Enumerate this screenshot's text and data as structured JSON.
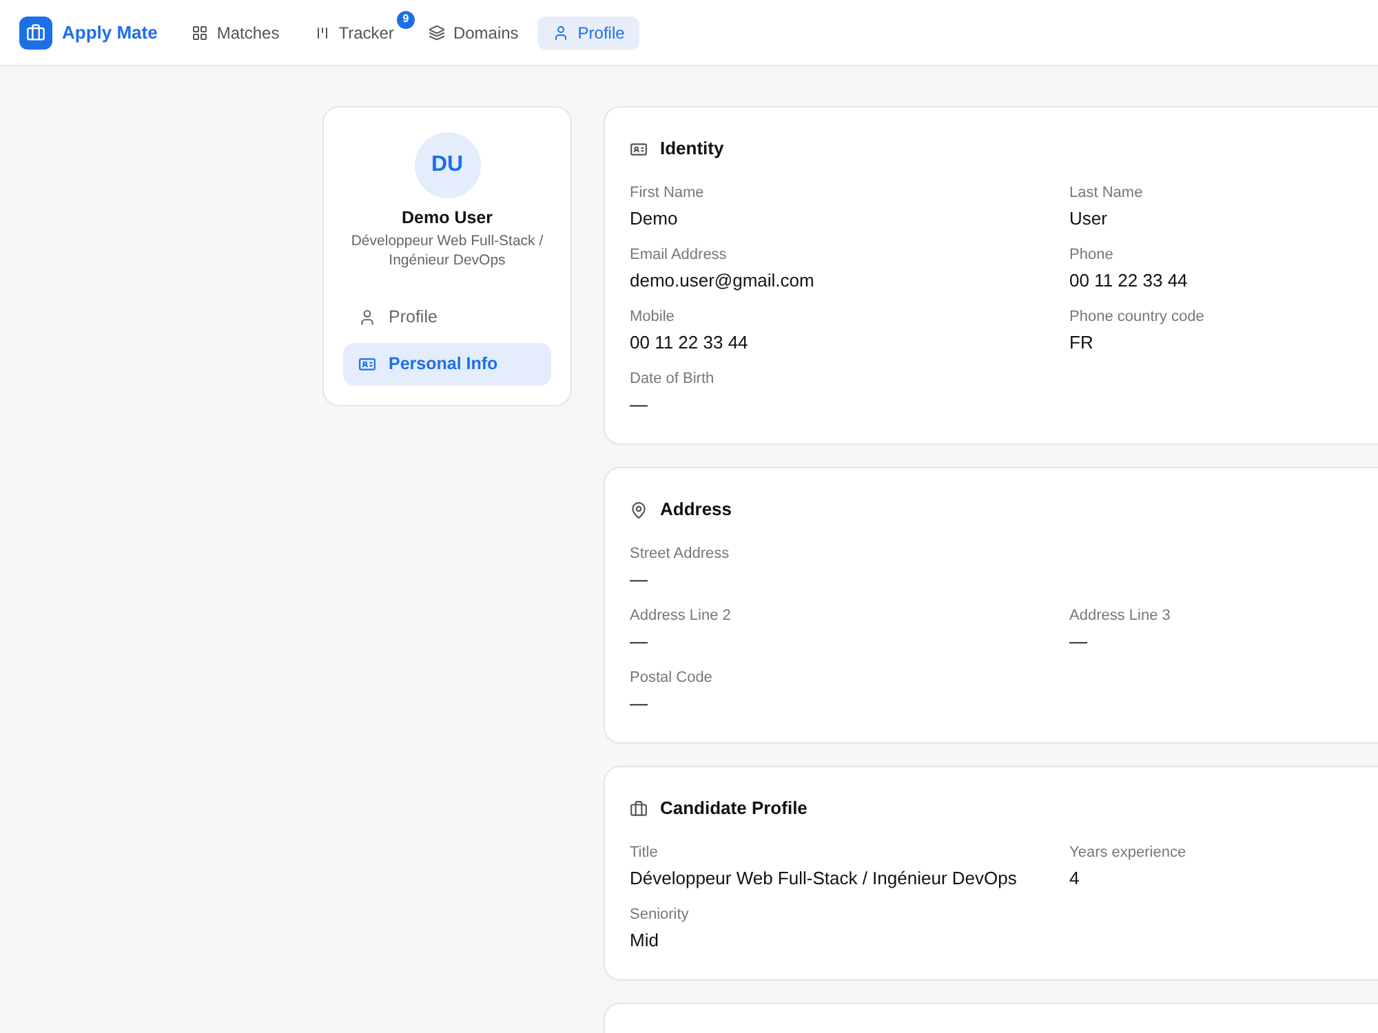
{
  "app": {
    "name": "Apply Mate"
  },
  "nav": [
    {
      "label": "Matches",
      "selected": false
    },
    {
      "label": "Tracker",
      "badge": "9",
      "selected": false
    },
    {
      "label": "Domains",
      "selected": false
    },
    {
      "label": "Profile",
      "selected": true
    }
  ],
  "sidebar": {
    "avatar": "DU",
    "name": "Demo User",
    "subtitle": "Développeur Web Full-Stack / Ingénieur DevOps",
    "items": [
      {
        "label": "Profile",
        "selected": false
      },
      {
        "label": "Personal Info",
        "selected": true
      }
    ]
  },
  "sections": [
    {
      "title": "Identity",
      "rows": [
        [
          {
            "label": "First Name",
            "value": "Demo"
          },
          {
            "label": "Last Name",
            "value": "User"
          }
        ],
        [
          {
            "label": "Email Address",
            "value": "demo.user@gmail.com"
          },
          {
            "label": "Phone",
            "value": "00 11 22 33 44"
          }
        ],
        [
          {
            "label": "Mobile",
            "value": "00 11 22 33 44"
          },
          {
            "label": "Phone country code",
            "value": "FR"
          }
        ],
        [
          {
            "label": "Date of Birth",
            "value": "—"
          }
        ]
      ]
    },
    {
      "title": "Address",
      "rows": [
        [
          {
            "label": "Street Address",
            "value": "—"
          }
        ],
        [
          {
            "label": "Address Line 2",
            "value": "—"
          },
          {
            "label": "Address Line 3",
            "value": "—"
          }
        ],
        [
          {
            "label": "Postal Code",
            "value": "—"
          }
        ]
      ]
    },
    {
      "title": "Candidate Profile",
      "rows": [
        [
          {
            "label": "Title",
            "value": "Développeur Web Full-Stack / Ingénieur DevOps"
          },
          {
            "label": "Years experience",
            "value": "4"
          }
        ],
        [
          {
            "label": "Seniority",
            "value": "Mid"
          }
        ]
      ]
    }
  ]
}
